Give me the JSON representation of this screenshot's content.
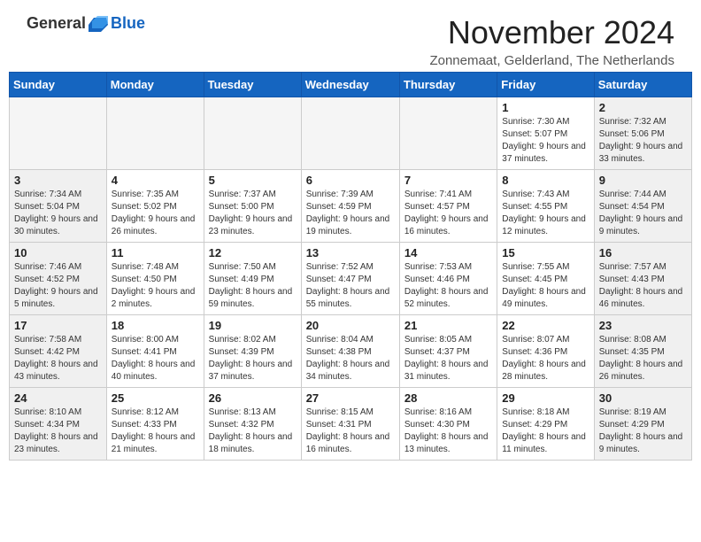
{
  "logo": {
    "general": "General",
    "blue": "Blue"
  },
  "title": "November 2024",
  "location": "Zonnemaat, Gelderland, The Netherlands",
  "weekdays": [
    "Sunday",
    "Monday",
    "Tuesday",
    "Wednesday",
    "Thursday",
    "Friday",
    "Saturday"
  ],
  "weeks": [
    [
      {
        "day": "",
        "info": ""
      },
      {
        "day": "",
        "info": ""
      },
      {
        "day": "",
        "info": ""
      },
      {
        "day": "",
        "info": ""
      },
      {
        "day": "",
        "info": ""
      },
      {
        "day": "1",
        "info": "Sunrise: 7:30 AM\nSunset: 5:07 PM\nDaylight: 9 hours and 37 minutes."
      },
      {
        "day": "2",
        "info": "Sunrise: 7:32 AM\nSunset: 5:06 PM\nDaylight: 9 hours and 33 minutes."
      }
    ],
    [
      {
        "day": "3",
        "info": "Sunrise: 7:34 AM\nSunset: 5:04 PM\nDaylight: 9 hours and 30 minutes."
      },
      {
        "day": "4",
        "info": "Sunrise: 7:35 AM\nSunset: 5:02 PM\nDaylight: 9 hours and 26 minutes."
      },
      {
        "day": "5",
        "info": "Sunrise: 7:37 AM\nSunset: 5:00 PM\nDaylight: 9 hours and 23 minutes."
      },
      {
        "day": "6",
        "info": "Sunrise: 7:39 AM\nSunset: 4:59 PM\nDaylight: 9 hours and 19 minutes."
      },
      {
        "day": "7",
        "info": "Sunrise: 7:41 AM\nSunset: 4:57 PM\nDaylight: 9 hours and 16 minutes."
      },
      {
        "day": "8",
        "info": "Sunrise: 7:43 AM\nSunset: 4:55 PM\nDaylight: 9 hours and 12 minutes."
      },
      {
        "day": "9",
        "info": "Sunrise: 7:44 AM\nSunset: 4:54 PM\nDaylight: 9 hours and 9 minutes."
      }
    ],
    [
      {
        "day": "10",
        "info": "Sunrise: 7:46 AM\nSunset: 4:52 PM\nDaylight: 9 hours and 5 minutes."
      },
      {
        "day": "11",
        "info": "Sunrise: 7:48 AM\nSunset: 4:50 PM\nDaylight: 9 hours and 2 minutes."
      },
      {
        "day": "12",
        "info": "Sunrise: 7:50 AM\nSunset: 4:49 PM\nDaylight: 8 hours and 59 minutes."
      },
      {
        "day": "13",
        "info": "Sunrise: 7:52 AM\nSunset: 4:47 PM\nDaylight: 8 hours and 55 minutes."
      },
      {
        "day": "14",
        "info": "Sunrise: 7:53 AM\nSunset: 4:46 PM\nDaylight: 8 hours and 52 minutes."
      },
      {
        "day": "15",
        "info": "Sunrise: 7:55 AM\nSunset: 4:45 PM\nDaylight: 8 hours and 49 minutes."
      },
      {
        "day": "16",
        "info": "Sunrise: 7:57 AM\nSunset: 4:43 PM\nDaylight: 8 hours and 46 minutes."
      }
    ],
    [
      {
        "day": "17",
        "info": "Sunrise: 7:58 AM\nSunset: 4:42 PM\nDaylight: 8 hours and 43 minutes."
      },
      {
        "day": "18",
        "info": "Sunrise: 8:00 AM\nSunset: 4:41 PM\nDaylight: 8 hours and 40 minutes."
      },
      {
        "day": "19",
        "info": "Sunrise: 8:02 AM\nSunset: 4:39 PM\nDaylight: 8 hours and 37 minutes."
      },
      {
        "day": "20",
        "info": "Sunrise: 8:04 AM\nSunset: 4:38 PM\nDaylight: 8 hours and 34 minutes."
      },
      {
        "day": "21",
        "info": "Sunrise: 8:05 AM\nSunset: 4:37 PM\nDaylight: 8 hours and 31 minutes."
      },
      {
        "day": "22",
        "info": "Sunrise: 8:07 AM\nSunset: 4:36 PM\nDaylight: 8 hours and 28 minutes."
      },
      {
        "day": "23",
        "info": "Sunrise: 8:08 AM\nSunset: 4:35 PM\nDaylight: 8 hours and 26 minutes."
      }
    ],
    [
      {
        "day": "24",
        "info": "Sunrise: 8:10 AM\nSunset: 4:34 PM\nDaylight: 8 hours and 23 minutes."
      },
      {
        "day": "25",
        "info": "Sunrise: 8:12 AM\nSunset: 4:33 PM\nDaylight: 8 hours and 21 minutes."
      },
      {
        "day": "26",
        "info": "Sunrise: 8:13 AM\nSunset: 4:32 PM\nDaylight: 8 hours and 18 minutes."
      },
      {
        "day": "27",
        "info": "Sunrise: 8:15 AM\nSunset: 4:31 PM\nDaylight: 8 hours and 16 minutes."
      },
      {
        "day": "28",
        "info": "Sunrise: 8:16 AM\nSunset: 4:30 PM\nDaylight: 8 hours and 13 minutes."
      },
      {
        "day": "29",
        "info": "Sunrise: 8:18 AM\nSunset: 4:29 PM\nDaylight: 8 hours and 11 minutes."
      },
      {
        "day": "30",
        "info": "Sunrise: 8:19 AM\nSunset: 4:29 PM\nDaylight: 8 hours and 9 minutes."
      }
    ]
  ]
}
